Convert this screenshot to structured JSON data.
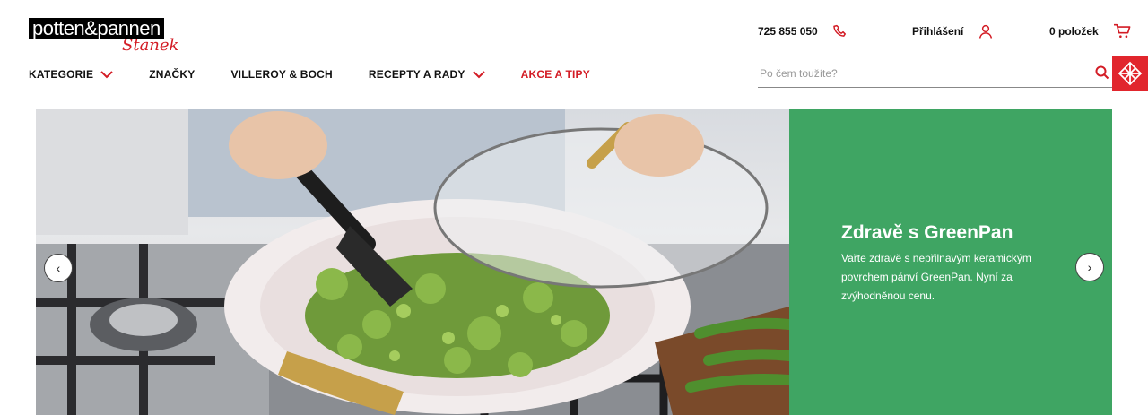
{
  "logo": {
    "main_text": "potten&pannen",
    "script_text": "Stanek"
  },
  "header": {
    "phone": "725 855 050",
    "login_label": "Přihlášení",
    "cart_label": "0 položek"
  },
  "nav": {
    "items": [
      {
        "label": "KATEGORIE",
        "has_dropdown": true
      },
      {
        "label": "ZNAČKY",
        "has_dropdown": false
      },
      {
        "label": "VILLEROY & BOCH",
        "has_dropdown": false
      },
      {
        "label": "RECEPTY A RADY",
        "has_dropdown": true
      },
      {
        "label": "AKCE A TIPY",
        "has_dropdown": false,
        "highlight": true
      }
    ]
  },
  "search": {
    "placeholder": "Po čem toužíte?",
    "value": ""
  },
  "hero": {
    "title": "Zdravě s GreenPan",
    "text": "Vařte zdravě s nepřilnavým keramickým povrchem pánví GreenPan. Nyní za zvýhodněnou cenu.",
    "panel_color": "#3fa563"
  },
  "colors": {
    "accent": "#d31c25",
    "badge": "#e1262d"
  },
  "carousel": {
    "prev_glyph": "‹",
    "next_glyph": "›"
  }
}
